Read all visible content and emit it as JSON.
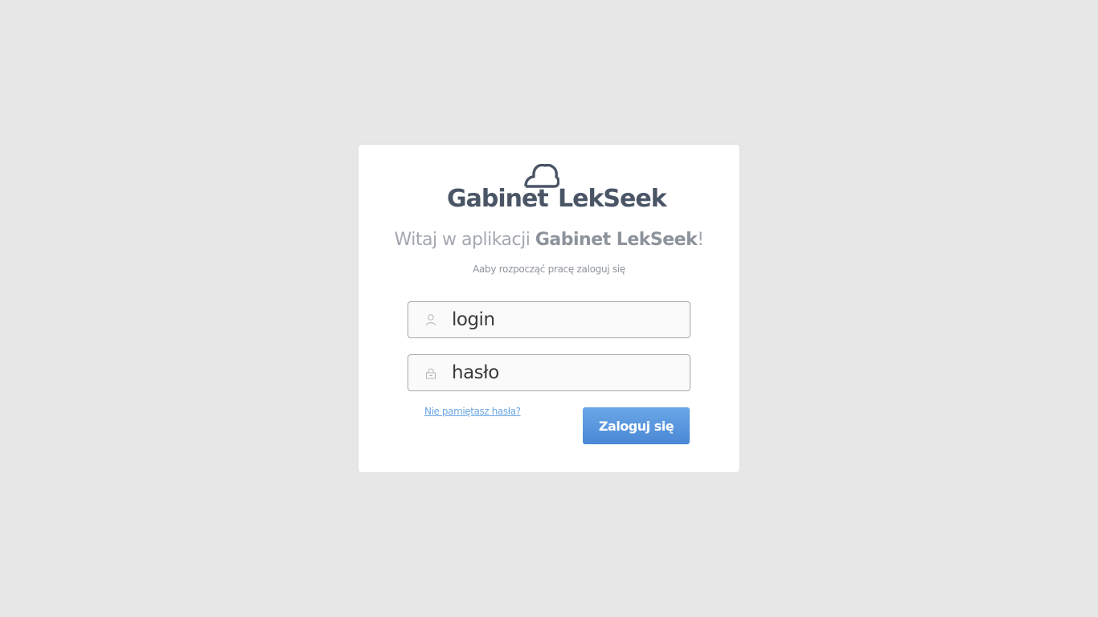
{
  "brand": {
    "name_left": "Gabinet",
    "name_right": "LekSeek",
    "color": "#4a5566"
  },
  "welcome": {
    "prefix": "Witaj w aplikacji ",
    "app_name": "Gabinet LekSeek",
    "suffix": "!"
  },
  "subtitle": "Aaby rozpocząć pracę zaloguj się",
  "form": {
    "login_placeholder": "login",
    "login_icon": "user-icon",
    "password_placeholder": "hasło",
    "password_icon": "lock-icon",
    "forgot_link": "Nie pamiętasz hasła?",
    "submit_label": "Zaloguj się",
    "accent_color": "#4a88d6"
  }
}
